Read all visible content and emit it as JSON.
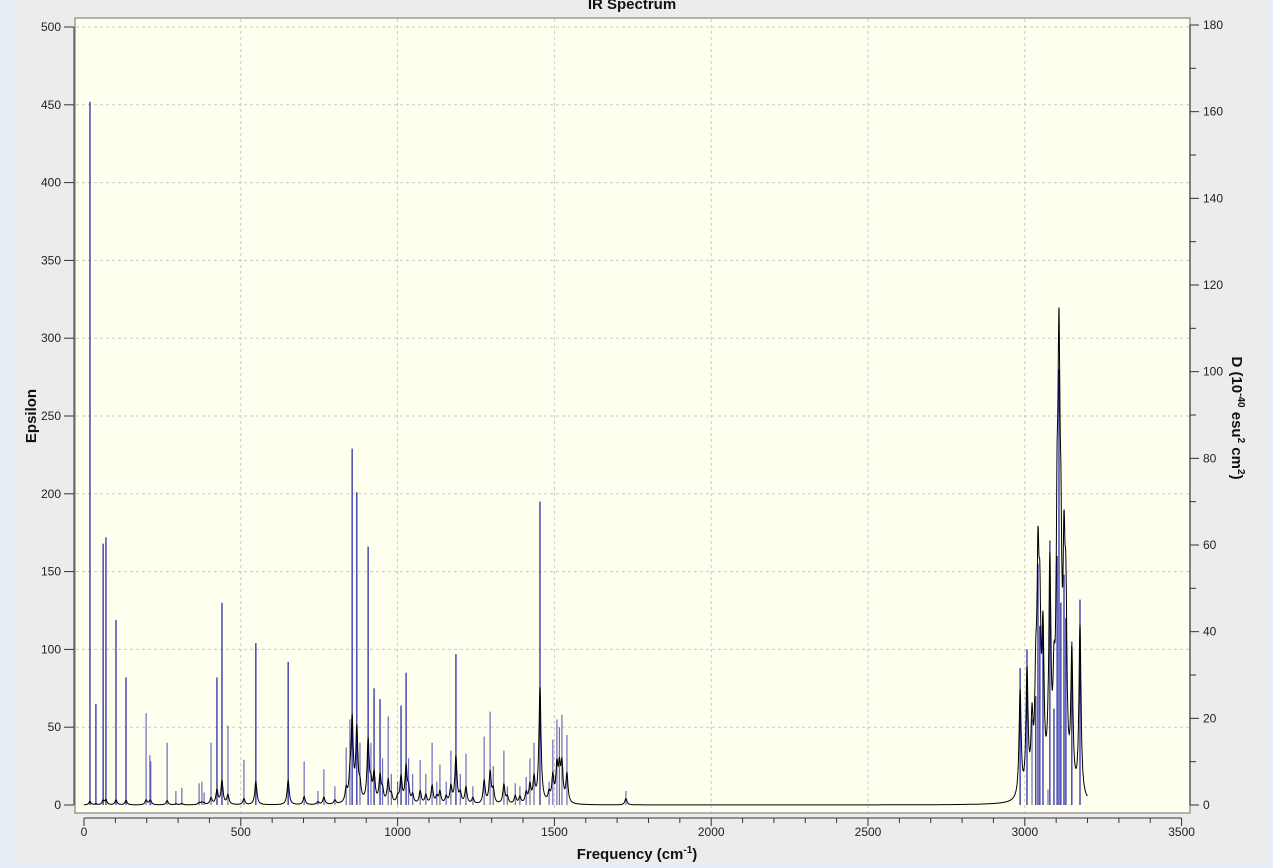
{
  "chart_data": {
    "type": "line",
    "title": "IR Spectrum",
    "xlabel": "Frequency (cm-1)",
    "xlabel_parts": {
      "base": "Frequency (cm",
      "sup": "-1",
      "end": ")"
    },
    "ylabel": "Epsilon",
    "ylabel_right": "D (10-40 esu2 cm2)",
    "ylabel_right_parts": {
      "a": "D (10",
      "sup1": "-40",
      "b": " esu",
      "sup2": "2",
      "c": " cm",
      "sup3": "2",
      "d": ")"
    },
    "xlim": [
      0,
      3500
    ],
    "ylim": [
      0,
      500
    ],
    "ylim_right": [
      0,
      180
    ],
    "x_ticks": [
      "0",
      "500",
      "1000",
      "1500",
      "2000",
      "2500",
      "3000",
      "3500"
    ],
    "y_ticks": [
      "0",
      "50",
      "100",
      "150",
      "200",
      "250",
      "300",
      "350",
      "400",
      "450",
      "500"
    ],
    "y_ticks_right": [
      "0",
      "20",
      "40",
      "60",
      "80",
      "100",
      "120",
      "140",
      "160",
      "180"
    ],
    "grid": true,
    "colors": {
      "plot_background": "#fffff0",
      "sticks": "#1c1ca8",
      "envelope": "#000000",
      "grid": "#c8c8c8"
    },
    "series": [
      {
        "type": "stick",
        "axis": "left",
        "points": [
          [
            19,
            452
          ],
          [
            38,
            65
          ],
          [
            61,
            168
          ],
          [
            70,
            172
          ],
          [
            102,
            119
          ],
          [
            134,
            82
          ],
          [
            198,
            59
          ],
          [
            210,
            32
          ],
          [
            213,
            28
          ],
          [
            265,
            40
          ],
          [
            293,
            9
          ],
          [
            312,
            11
          ],
          [
            367,
            14
          ],
          [
            376,
            15
          ],
          [
            383,
            8
          ],
          [
            405,
            40
          ],
          [
            424,
            82
          ],
          [
            440,
            130
          ],
          [
            459,
            51
          ],
          [
            510,
            29
          ],
          [
            548,
            104
          ],
          [
            651,
            92
          ],
          [
            702,
            28
          ],
          [
            746,
            9
          ],
          [
            765,
            23
          ],
          [
            800,
            12
          ],
          [
            836,
            37
          ],
          [
            848,
            55
          ],
          [
            855,
            229
          ],
          [
            870,
            201
          ],
          [
            880,
            40
          ],
          [
            906,
            166
          ],
          [
            915,
            40
          ],
          [
            925,
            75
          ],
          [
            944,
            68
          ],
          [
            952,
            30
          ],
          [
            970,
            57
          ],
          [
            980,
            20
          ],
          [
            1000,
            15
          ],
          [
            1011,
            64
          ],
          [
            1027,
            85
          ],
          [
            1035,
            30
          ],
          [
            1048,
            20
          ],
          [
            1072,
            29
          ],
          [
            1090,
            20
          ],
          [
            1110,
            40
          ],
          [
            1125,
            15
          ],
          [
            1135,
            26
          ],
          [
            1155,
            15
          ],
          [
            1170,
            35
          ],
          [
            1186,
            97
          ],
          [
            1200,
            20
          ],
          [
            1218,
            33
          ],
          [
            1240,
            12
          ],
          [
            1276,
            44
          ],
          [
            1295,
            60
          ],
          [
            1305,
            25
          ],
          [
            1339,
            35
          ],
          [
            1350,
            12
          ],
          [
            1375,
            14
          ],
          [
            1390,
            12
          ],
          [
            1410,
            18
          ],
          [
            1422,
            30
          ],
          [
            1435,
            40
          ],
          [
            1454,
            195
          ],
          [
            1483,
            15
          ],
          [
            1495,
            42
          ],
          [
            1508,
            55
          ],
          [
            1516,
            50
          ],
          [
            1524,
            58
          ],
          [
            1540,
            45
          ],
          [
            1728,
            9
          ],
          [
            2985,
            88
          ],
          [
            3007,
            100
          ],
          [
            3023,
            55
          ],
          [
            3035,
            70
          ],
          [
            3042,
            155
          ],
          [
            3048,
            115
          ],
          [
            3058,
            115
          ],
          [
            3074,
            10
          ],
          [
            3080,
            170
          ],
          [
            3093,
            62
          ],
          [
            3103,
            160
          ],
          [
            3109,
            280
          ],
          [
            3115,
            130
          ],
          [
            3125,
            148
          ],
          [
            3131,
            120
          ],
          [
            3150,
            105
          ],
          [
            3176,
            132
          ]
        ]
      },
      {
        "type": "envelope",
        "axis": "left"
      }
    ]
  }
}
